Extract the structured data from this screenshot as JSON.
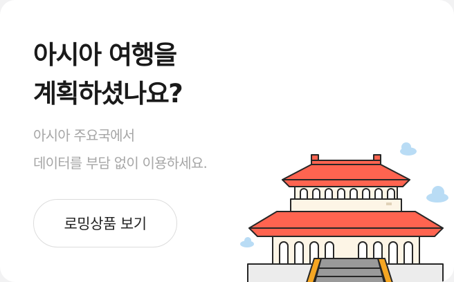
{
  "hero": {
    "title_lines": [
      "아시아 여행을",
      "계획하셨나요?"
    ],
    "subtitle_lines": [
      "아시아 주요국에서",
      "데이터를 부담 없이 이용하세요."
    ]
  },
  "cta": {
    "label": "로밍상품 보기"
  },
  "illustration": {
    "icon": "asian-palace-icon",
    "colors": {
      "roof": "#ff6450",
      "wall": "#fdf5e6",
      "outline": "#262626",
      "stairs": "#f5a623",
      "cloud": "#b9dcf5"
    }
  }
}
